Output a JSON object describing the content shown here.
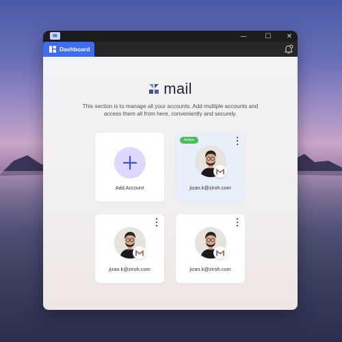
{
  "window": {
    "tab_label": "Dashboard"
  },
  "brand": {
    "name": "mail",
    "accent": "#3d6cf5"
  },
  "description": "This section is to manage all your accounts. Add multiple accounts and access them all from here, conveniently and securely.",
  "add_card": {
    "label": "Add Account"
  },
  "accounts": [
    {
      "email": "jizan.k@ziroh.com",
      "status": "Active"
    },
    {
      "email": "jizan.k@ziroh.com"
    },
    {
      "email": "jizan.k@ziroh.com"
    }
  ],
  "colors": {
    "active_badge": "#4cbb5b",
    "active_card_bg": "#e9eefb",
    "add_circle_bg": "#dcd8ff"
  }
}
